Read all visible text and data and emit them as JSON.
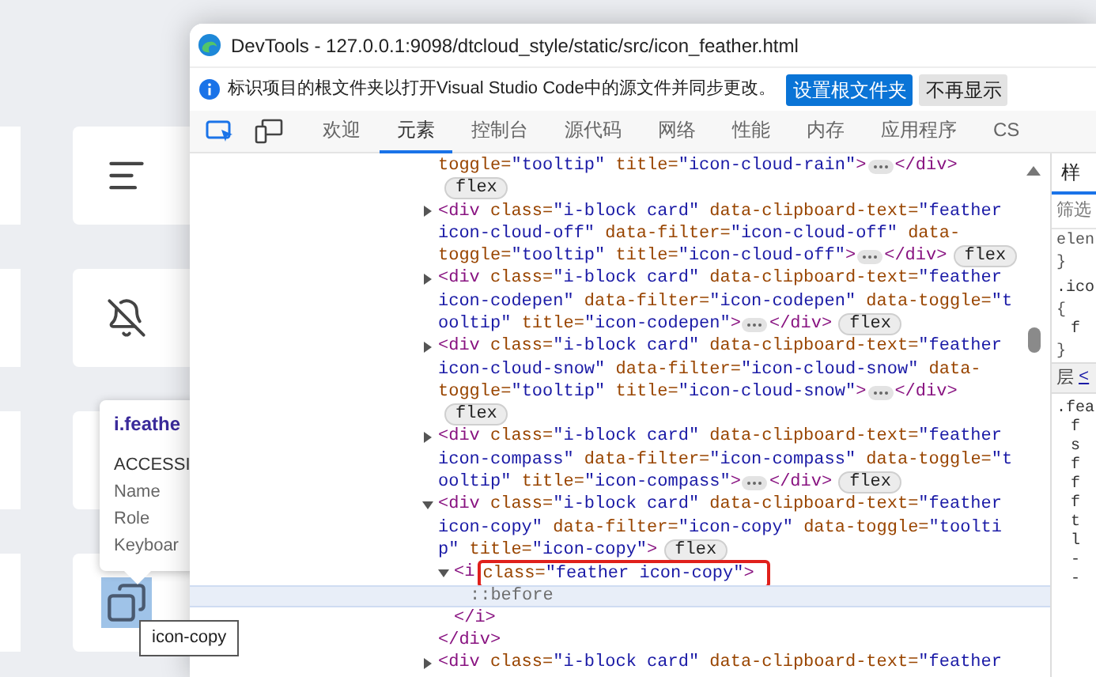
{
  "page": {
    "cards": [
      {
        "kind": "align-left",
        "selected": false
      },
      {
        "kind": "bell-off",
        "selected": false
      },
      {
        "kind": "hidden"
      },
      {
        "kind": "copy",
        "selected": true
      }
    ],
    "accessibility_tooltip": {
      "title": "i.feathe",
      "heading": "ACCESSI",
      "rows": [
        "Name",
        "Role",
        "Keyboar"
      ]
    },
    "title_tooltip": "icon-copy"
  },
  "window": {
    "title": "DevTools - 127.0.0.1:9098/dtcloud_style/static/src/icon_feather.html"
  },
  "infobar": {
    "message": "标识项目的根文件夹以打开Visual Studio Code中的源文件并同步更改。",
    "buttons": [
      {
        "label": "设置根文件夹",
        "kind": "primary"
      },
      {
        "label": "不再显示",
        "kind": "secondary"
      }
    ]
  },
  "tabs": [
    {
      "label": "欢迎",
      "selected": false
    },
    {
      "label": "元素",
      "selected": true
    },
    {
      "label": "控制台",
      "selected": false
    },
    {
      "label": "源代码",
      "selected": false
    },
    {
      "label": "网络",
      "selected": false
    },
    {
      "label": "性能",
      "selected": false
    },
    {
      "label": "内存",
      "selected": false
    },
    {
      "label": "应用程序",
      "selected": false
    },
    {
      "label": "CS",
      "selected": false
    }
  ],
  "dom_tree": [
    {
      "selected": false,
      "lines": [
        [
          {
            "kind": "attr",
            "text": "toggle="
          },
          {
            "kind": "value",
            "text": "\"tooltip\""
          },
          {
            "kind": "attr",
            "text": " title="
          },
          {
            "kind": "value",
            "text": "\"icon-cloud-rain\""
          },
          {
            "kind": "tag",
            "text": ">"
          },
          {
            "kind": "more"
          },
          {
            "kind": "tag",
            "text": "</div>"
          }
        ],
        [
          {
            "kind": "badge",
            "text": "flex"
          }
        ]
      ]
    },
    {
      "selected": false,
      "expanded": false,
      "lines": [
        [
          {
            "kind": "tag",
            "text": "<div"
          },
          {
            "kind": "attr",
            "text": " class="
          },
          {
            "kind": "value",
            "text": "\"i-block card\""
          },
          {
            "kind": "attr",
            "text": " data-clipboard-text="
          },
          {
            "kind": "value",
            "text": "\"feather"
          }
        ],
        [
          {
            "kind": "value",
            "text": "icon-cloud-off\""
          },
          {
            "kind": "attr",
            "text": " data-filter="
          },
          {
            "kind": "value",
            "text": "\"icon-cloud-off\""
          },
          {
            "kind": "attr",
            "text": " data-"
          }
        ],
        [
          {
            "kind": "attr",
            "text": "toggle="
          },
          {
            "kind": "value",
            "text": "\"tooltip\""
          },
          {
            "kind": "attr",
            "text": " title="
          },
          {
            "kind": "value",
            "text": "\"icon-cloud-off\""
          },
          {
            "kind": "tag",
            "text": ">"
          },
          {
            "kind": "more"
          },
          {
            "kind": "tag",
            "text": "</div>"
          },
          {
            "kind": "badge",
            "text": "flex"
          }
        ]
      ]
    },
    {
      "selected": false,
      "expanded": false,
      "lines": [
        [
          {
            "kind": "tag",
            "text": "<div"
          },
          {
            "kind": "attr",
            "text": " class="
          },
          {
            "kind": "value",
            "text": "\"i-block card\""
          },
          {
            "kind": "attr",
            "text": " data-clipboard-text="
          },
          {
            "kind": "value",
            "text": "\"feather"
          }
        ],
        [
          {
            "kind": "value",
            "text": "icon-codepen\""
          },
          {
            "kind": "attr",
            "text": " data-filter="
          },
          {
            "kind": "value",
            "text": "\"icon-codepen\""
          },
          {
            "kind": "attr",
            "text": " data-toggle="
          },
          {
            "kind": "value",
            "text": "\"t"
          }
        ],
        [
          {
            "kind": "value",
            "text": "ooltip\""
          },
          {
            "kind": "attr",
            "text": " title="
          },
          {
            "kind": "value",
            "text": "\"icon-codepen\""
          },
          {
            "kind": "tag",
            "text": ">"
          },
          {
            "kind": "more"
          },
          {
            "kind": "tag",
            "text": "</div>"
          },
          {
            "kind": "badge",
            "text": "flex"
          }
        ]
      ]
    },
    {
      "selected": false,
      "expanded": false,
      "lines": [
        [
          {
            "kind": "tag",
            "text": "<div"
          },
          {
            "kind": "attr",
            "text": " class="
          },
          {
            "kind": "value",
            "text": "\"i-block card\""
          },
          {
            "kind": "attr",
            "text": " data-clipboard-text="
          },
          {
            "kind": "value",
            "text": "\"feather"
          }
        ],
        [
          {
            "kind": "value",
            "text": "icon-cloud-snow\""
          },
          {
            "kind": "attr",
            "text": " data-filter="
          },
          {
            "kind": "value",
            "text": "\"icon-cloud-snow\""
          },
          {
            "kind": "attr",
            "text": " data-"
          }
        ],
        [
          {
            "kind": "attr",
            "text": "toggle="
          },
          {
            "kind": "value",
            "text": "\"tooltip\""
          },
          {
            "kind": "attr",
            "text": " title="
          },
          {
            "kind": "value",
            "text": "\"icon-cloud-snow\""
          },
          {
            "kind": "tag",
            "text": ">"
          },
          {
            "kind": "more"
          },
          {
            "kind": "tag",
            "text": "</div>"
          }
        ],
        [
          {
            "kind": "badge",
            "text": "flex"
          }
        ]
      ]
    },
    {
      "selected": false,
      "expanded": false,
      "lines": [
        [
          {
            "kind": "tag",
            "text": "<div"
          },
          {
            "kind": "attr",
            "text": " class="
          },
          {
            "kind": "value",
            "text": "\"i-block card\""
          },
          {
            "kind": "attr",
            "text": " data-clipboard-text="
          },
          {
            "kind": "value",
            "text": "\"feather"
          }
        ],
        [
          {
            "kind": "value",
            "text": "icon-compass\""
          },
          {
            "kind": "attr",
            "text": " data-filter="
          },
          {
            "kind": "value",
            "text": "\"icon-compass\""
          },
          {
            "kind": "attr",
            "text": " data-toggle="
          },
          {
            "kind": "value",
            "text": "\"t"
          }
        ],
        [
          {
            "kind": "value",
            "text": "ooltip\""
          },
          {
            "kind": "attr",
            "text": " title="
          },
          {
            "kind": "value",
            "text": "\"icon-compass\""
          },
          {
            "kind": "tag",
            "text": ">"
          },
          {
            "kind": "more"
          },
          {
            "kind": "tag",
            "text": "</div>"
          },
          {
            "kind": "badge",
            "text": "flex"
          }
        ]
      ]
    },
    {
      "selected": false,
      "expanded": true,
      "lines": [
        [
          {
            "kind": "tag",
            "text": "<div"
          },
          {
            "kind": "attr",
            "text": " class="
          },
          {
            "kind": "value",
            "text": "\"i-block card\""
          },
          {
            "kind": "attr",
            "text": " data-clipboard-text="
          },
          {
            "kind": "value",
            "text": "\"feather"
          }
        ],
        [
          {
            "kind": "value",
            "text": "icon-copy\""
          },
          {
            "kind": "attr",
            "text": " data-filter="
          },
          {
            "kind": "value",
            "text": "\"icon-copy\""
          },
          {
            "kind": "attr",
            "text": " data-toggle="
          },
          {
            "kind": "value",
            "text": "\"toolti"
          }
        ],
        [
          {
            "kind": "value",
            "text": "p\""
          },
          {
            "kind": "attr",
            "text": " title="
          },
          {
            "kind": "value",
            "text": "\"icon-copy\""
          },
          {
            "kind": "tag",
            "text": ">"
          },
          {
            "kind": "badge",
            "text": "flex"
          }
        ]
      ],
      "children": [
        {
          "selected": false,
          "expanded": true,
          "outlined": true,
          "lines": [
            [
              {
                "kind": "tag",
                "text": "<i"
              },
              {
                "kind": "attr",
                "text": "class="
              },
              {
                "kind": "value",
                "text": "\"feather icon-copy\""
              },
              {
                "kind": "tag",
                "text": ">"
              }
            ]
          ],
          "children": [
            {
              "selected": true,
              "lines": [
                [
                  {
                    "kind": "pseudo",
                    "text": "::before"
                  }
                ]
              ]
            }
          ],
          "close": [
            {
              "kind": "tag",
              "text": "</i>"
            }
          ]
        }
      ],
      "close": [
        {
          "kind": "tag",
          "text": "</div>"
        }
      ]
    },
    {
      "selected": false,
      "expanded": false,
      "lines": [
        [
          {
            "kind": "tag",
            "text": "<div"
          },
          {
            "kind": "attr",
            "text": " class="
          },
          {
            "kind": "value",
            "text": "\"i-block card\""
          },
          {
            "kind": "attr",
            "text": " data-clipboard-text="
          },
          {
            "kind": "value",
            "text": "\"feather"
          }
        ]
      ]
    }
  ],
  "styles_panel": {
    "tab": {
      "label": "样",
      "selected": true
    },
    "filter": {
      "placeholder": "筛选"
    },
    "lines": [
      {
        "kind": "code",
        "text": "elen"
      },
      {
        "kind": "code",
        "text": "}"
      },
      {
        "kind": "selector",
        "text": ".ico"
      },
      {
        "kind": "code",
        "text": "{"
      },
      {
        "kind": "prop",
        "text": "f"
      },
      {
        "kind": "code",
        "text": "}"
      },
      {
        "kind": "section",
        "text": "层",
        "link": "<"
      },
      {
        "kind": "selector",
        "text": ".fea"
      },
      {
        "kind": "prop",
        "text": "f"
      },
      {
        "kind": "prop",
        "text": "s"
      },
      {
        "kind": "prop",
        "text": "f"
      },
      {
        "kind": "prop",
        "text": "f"
      },
      {
        "kind": "prop",
        "text": "f"
      },
      {
        "kind": "prop",
        "text": "t"
      },
      {
        "kind": "prop",
        "text": "l"
      },
      {
        "kind": "prop",
        "text": "-"
      },
      {
        "kind": "prop",
        "text": "-"
      }
    ]
  }
}
